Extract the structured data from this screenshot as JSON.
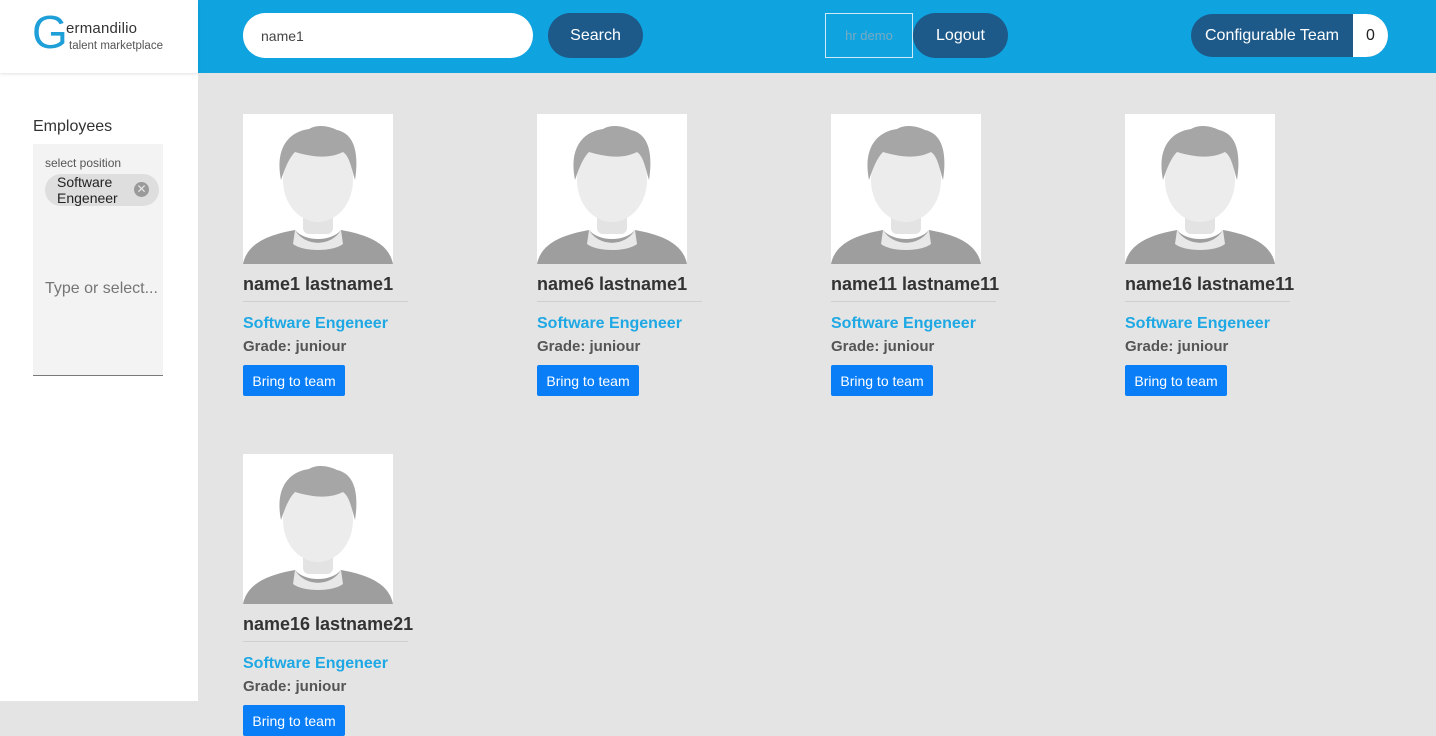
{
  "logo": {
    "letter": "G",
    "name": "ermandilio",
    "tagline": "talent marketplace"
  },
  "header": {
    "search_value": "name1",
    "search_label": "Search",
    "user_label": "hr demo",
    "logout_label": "Logout",
    "team_label": "Configurable Team",
    "team_count": "0"
  },
  "sidebar": {
    "title": "Employees",
    "filter_label": "select position",
    "chip_label": "Software Engeneer",
    "input_placeholder": "Type or select..."
  },
  "employees": [
    {
      "name": "name1 lastname1",
      "position": "Software Engeneer",
      "grade": "Grade: juniour",
      "button": "Bring to team"
    },
    {
      "name": "name6 lastname1",
      "position": "Software Engeneer",
      "grade": "Grade: juniour",
      "button": "Bring to team"
    },
    {
      "name": "name11 lastname11",
      "position": "Software Engeneer",
      "grade": "Grade: juniour",
      "button": "Bring to team"
    },
    {
      "name": "name16 lastname11",
      "position": "Software Engeneer",
      "grade": "Grade: juniour",
      "button": "Bring to team"
    },
    {
      "name": "name16 lastname21",
      "position": "Software Engeneer",
      "grade": "Grade: juniour",
      "button": "Bring to team"
    }
  ],
  "colors": {
    "topbar": "#0fa4e0",
    "button_dark": "#1d5a8a",
    "accent": "#1ea8e4",
    "action": "#0a7ef7"
  }
}
